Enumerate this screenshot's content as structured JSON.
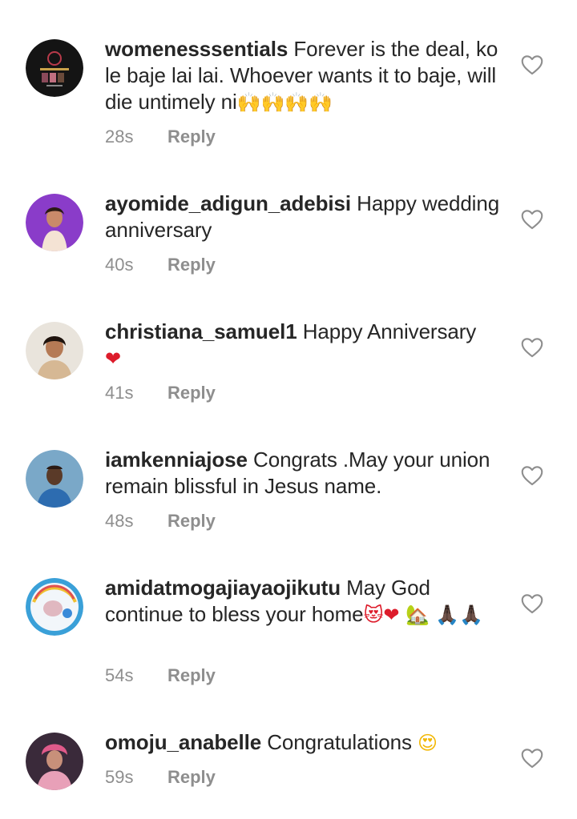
{
  "comments": [
    {
      "username": "womenesssentials",
      "text": "Forever is the deal, ko le baje lai lai. Whoever wants it to baje, will die untimely ni",
      "emojis": "🙌🙌🙌🙌",
      "time": "28s",
      "reply": "Reply",
      "avatar_icon": "brand-logo-avatar"
    },
    {
      "username": "ayomide_adigun_adebisi",
      "text": "Happy wedding anniversary",
      "emojis": "",
      "time": "40s",
      "reply": "Reply",
      "avatar_icon": "profile-photo-avatar"
    },
    {
      "username": "christiana_samuel1",
      "text": "Happy Anniversary",
      "emojis": "❤",
      "time": "41s",
      "reply": "Reply",
      "avatar_icon": "profile-photo-avatar"
    },
    {
      "username": "iamkenniajose",
      "text": "Congrats .May your union remain blissful in Jesus name.",
      "emojis": "",
      "time": "48s",
      "reply": "Reply",
      "avatar_icon": "profile-photo-avatar"
    },
    {
      "username": "amidatmogajiayaojikutu",
      "text": "May God continue to bless your home",
      "emojis": "😻❤ 🏡 🙏🏿🙏🏿",
      "time": "54s",
      "reply": "Reply",
      "avatar_icon": "profile-photo-avatar"
    },
    {
      "username": "omoju_anabelle",
      "text": "Congratulations",
      "emojis": "😍",
      "time": "59s",
      "reply": "Reply",
      "avatar_icon": "profile-photo-avatar"
    }
  ],
  "colors": {
    "text": "#262626",
    "muted": "#8e8e8e",
    "like_icon": "#8e8e8e"
  }
}
